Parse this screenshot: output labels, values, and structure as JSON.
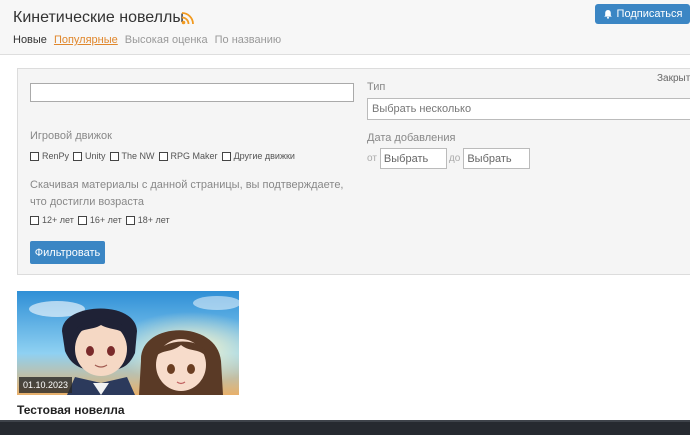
{
  "header": {
    "title": "Кинетические новеллы",
    "subscribe_label": "Подписаться",
    "tabs": [
      {
        "label": "Новые"
      },
      {
        "label": "Популярные"
      },
      {
        "label": "Высокая оценка"
      },
      {
        "label": "По названию"
      }
    ]
  },
  "filter": {
    "collapse_label": "Закрыть",
    "search_value": "",
    "type_label": "Тип",
    "type_placeholder": "Выбрать несколько",
    "engine_label": "Игровой движок",
    "engines": [
      "RenPy",
      "Unity",
      "The NW",
      "RPG Maker",
      "Другие движки"
    ],
    "date_label": "Дата добавления",
    "date_from_label": "от",
    "date_from_placeholder": "Выбрать",
    "date_to_label": "до",
    "date_to_placeholder": "Выбрать",
    "age_note": "Скачивая материалы с данной страницы, вы подтверждаете, что достигли возраста",
    "ages": [
      "12+ лет",
      "16+ лет",
      "18+ лет"
    ],
    "submit_label": "Фильтровать"
  },
  "card": {
    "date": "01.10.2023",
    "title": "Тестовая новелла"
  },
  "colors": {
    "accent": "#3b86c4",
    "active_tab": "#e0872c",
    "rss": "#f29a1f"
  }
}
